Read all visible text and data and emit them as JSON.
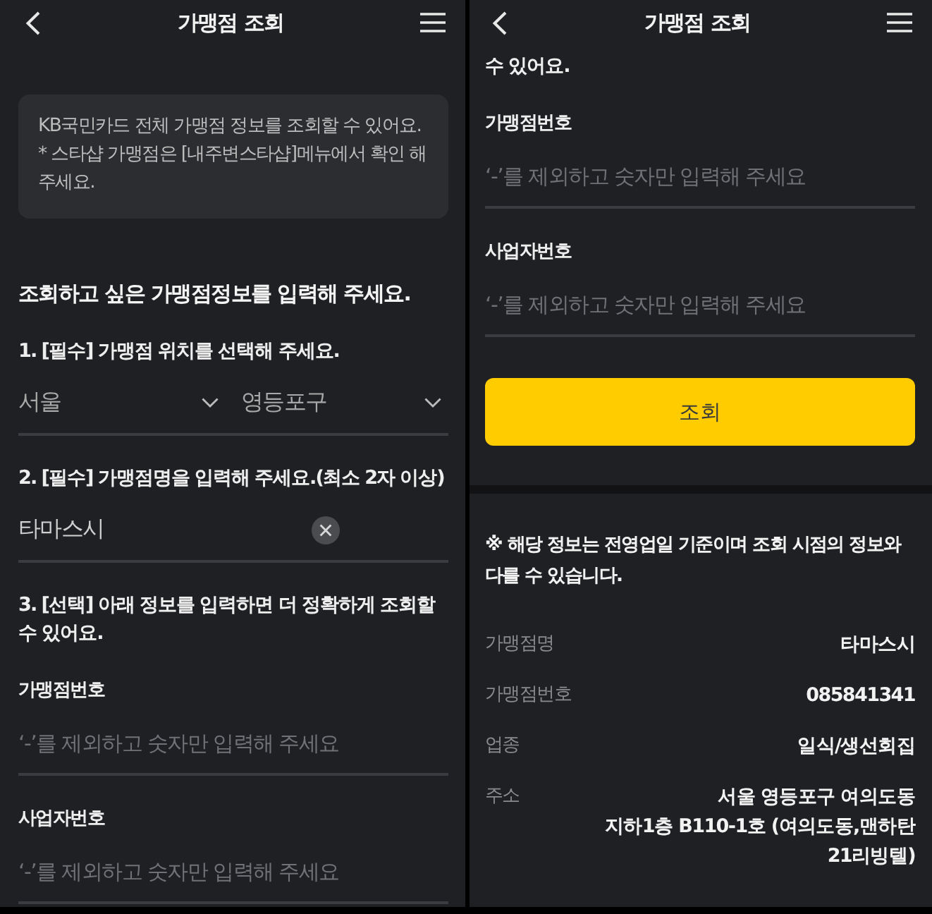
{
  "screens": [
    {
      "header": {
        "title": "가맹점 조회"
      },
      "blocks": [
        {
          "kind": "info_box",
          "lines": [
            "KB국민카드 전체 가맹점 정보를 조회할 수 있어요.",
            "* 스타샵 가맹점은 [내주변스타샵]메뉴에서 확인 해 주세요."
          ]
        },
        {
          "kind": "heading",
          "text": "조회하고 싶은 가맹점정보를 입력해 주세요."
        },
        {
          "kind": "step_label",
          "text": "1. [필수] 가맹점 위치를 선택해 주세요."
        },
        {
          "kind": "dropdowns",
          "items": [
            {
              "value": "서울"
            },
            {
              "value": "영등포구"
            }
          ]
        },
        {
          "kind": "step_label",
          "text": "2. [필수] 가맹점명을 입력해 주세요.(최소 2자 이상)"
        },
        {
          "kind": "text_field",
          "value": "타마스시",
          "clear_button": true
        },
        {
          "kind": "step_label",
          "text": "3. [선택] 아래 정보를 입력하면 더 정확하게 조회할 수 있어요."
        },
        {
          "kind": "field_label",
          "text": "가맹점번호"
        },
        {
          "kind": "text_field",
          "placeholder": "‘-’를 제외하고 숫자만 입력해 주세요"
        },
        {
          "kind": "field_label",
          "text": "사업자번호"
        },
        {
          "kind": "text_field",
          "placeholder": "‘-’를 제외하고 숫자만 입력해 주세요"
        }
      ]
    },
    {
      "header": {
        "title": "가맹점 조회"
      },
      "blocks": [
        {
          "kind": "step_label",
          "text": "수 있어요."
        },
        {
          "kind": "field_label",
          "text": "가맹점번호"
        },
        {
          "kind": "text_field",
          "placeholder": "‘-’를 제외하고 숫자만 입력해 주세요"
        },
        {
          "kind": "field_label",
          "text": "사업자번호"
        },
        {
          "kind": "text_field",
          "placeholder": "‘-’를 제외하고 숫자만 입력해 주세요"
        },
        {
          "kind": "button",
          "text": "조회"
        },
        {
          "kind": "results",
          "notice": "※ 해당 정보는 전영업일 기준이며 조회 시점의 정보와 다를 수 있습니다.",
          "rows": [
            {
              "label": "가맹점명",
              "value": "타마스시"
            },
            {
              "label": "가맹점번호",
              "value": "085841341"
            },
            {
              "label": "업종",
              "value": "일식/생선회집"
            },
            {
              "label": "주소",
              "value": "서울 영등포구 여의도동\n지하1층 B110-1호 (여의도동,맨하탄 21리빙텔)"
            }
          ]
        }
      ]
    }
  ]
}
